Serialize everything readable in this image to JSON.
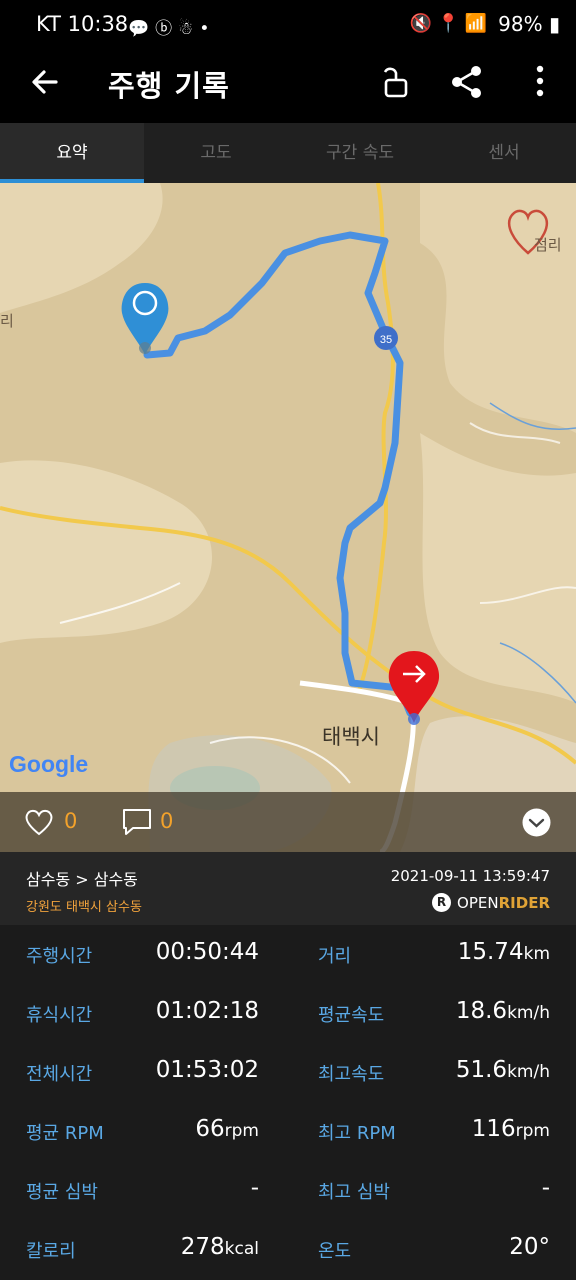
{
  "status": {
    "carrier_time": "KT 10:38",
    "battery": "98%",
    "left_icons": [
      "talk-icon",
      "b-icon",
      "alien-icon",
      "dot-icon"
    ],
    "right_icons": [
      "mute-icon",
      "location-icon",
      "wifi-icon",
      "hd-icon",
      "signal-icon"
    ]
  },
  "appbar": {
    "title": "주행 기록"
  },
  "tabs": [
    "요약",
    "고도",
    "구간 속도",
    "센서"
  ],
  "map": {
    "labels": {
      "city": "태백시",
      "village": "점리",
      "edge": "리",
      "road_badge": "35"
    },
    "google": "Google"
  },
  "social": {
    "likes": "0",
    "comments": "0"
  },
  "ride": {
    "route": "삼수동 > 삼수동",
    "region": "강원도 태백시 삼수동",
    "datetime": "2021-09-11 13:59:47",
    "brand_open": "OPEN",
    "brand_rider": "RIDER",
    "brand_logo": "R"
  },
  "stats": [
    {
      "label": "주행시간",
      "value": "00:50:44",
      "unit": ""
    },
    {
      "label": "거리",
      "value": "15.74",
      "unit": "km"
    },
    {
      "label": "휴식시간",
      "value": "01:02:18",
      "unit": ""
    },
    {
      "label": "평균속도",
      "value": "18.6",
      "unit": "km/h"
    },
    {
      "label": "전체시간",
      "value": "01:53:02",
      "unit": ""
    },
    {
      "label": "최고속도",
      "value": "51.6",
      "unit": "km/h"
    },
    {
      "label": "평균 RPM",
      "value": "66",
      "unit": "rpm"
    },
    {
      "label": "최고 RPM",
      "value": "116",
      "unit": "rpm"
    },
    {
      "label": "평균 심박",
      "value": "-",
      "unit": ""
    },
    {
      "label": "최고 심박",
      "value": "-",
      "unit": ""
    },
    {
      "label": "칼로리",
      "value": "278",
      "unit": "kcal"
    },
    {
      "label": "온도",
      "value": "20°",
      "unit": ""
    }
  ],
  "colors": {
    "accent": "#2d8fd5",
    "label_blue": "#5aa8e4",
    "orange": "#f3a22b",
    "route": "#4a90e2",
    "end_marker": "#e3161c"
  }
}
